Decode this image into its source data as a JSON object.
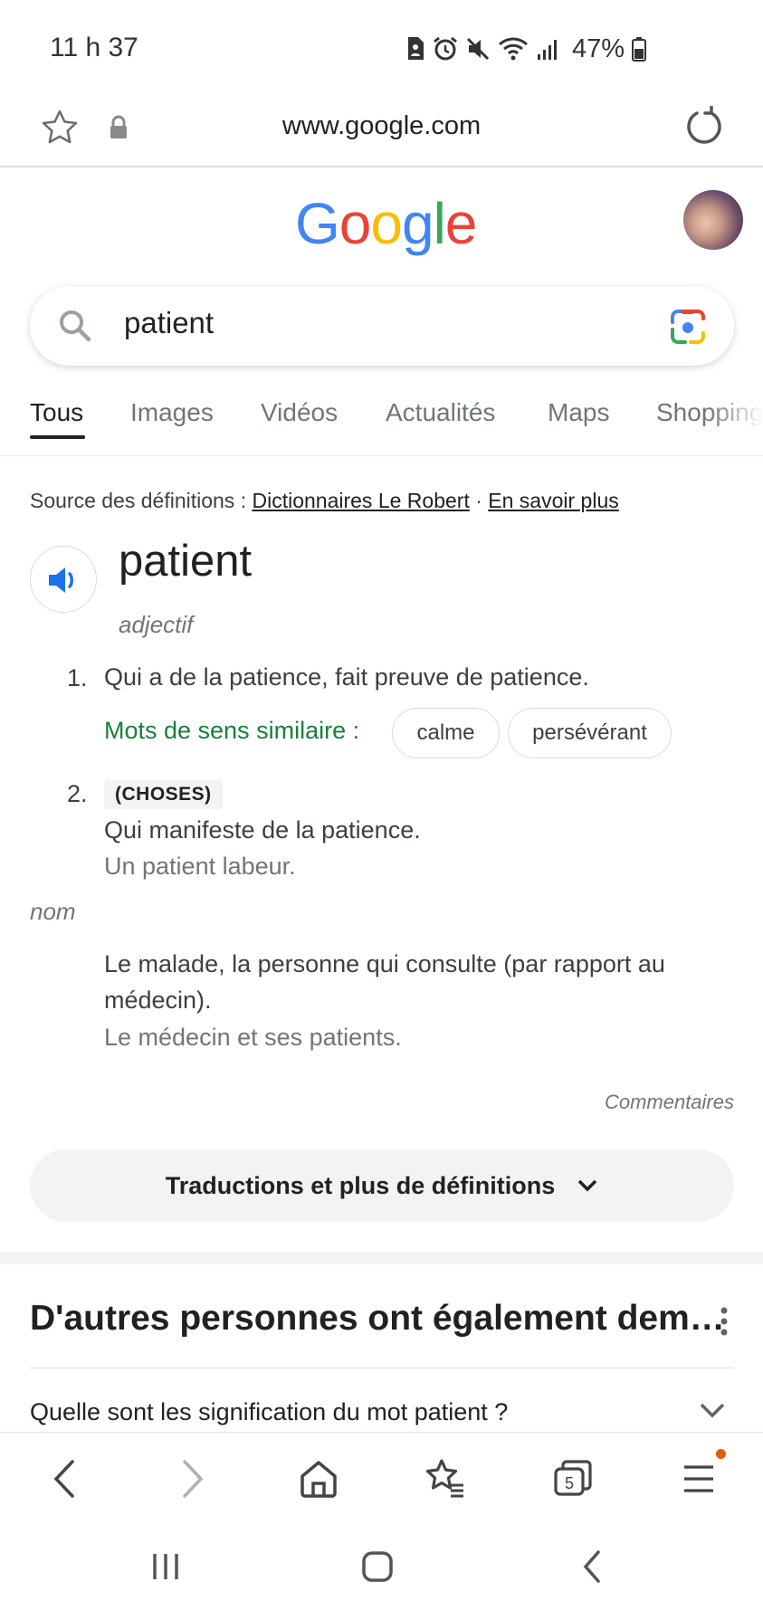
{
  "status_bar": {
    "time": "11 h 37",
    "battery": "47%",
    "icons": [
      "sim-icon",
      "alarm-icon",
      "mute-icon",
      "wifi-icon",
      "signal-icon",
      "battery-icon"
    ]
  },
  "browser": {
    "url": "www.google.com"
  },
  "google": {
    "logo_letters": [
      {
        "ch": "G",
        "color": "#4285F4"
      },
      {
        "ch": "o",
        "color": "#EA4335"
      },
      {
        "ch": "o",
        "color": "#FBBC05"
      },
      {
        "ch": "g",
        "color": "#4285F4"
      },
      {
        "ch": "l",
        "color": "#34A853"
      },
      {
        "ch": "e",
        "color": "#EA4335"
      }
    ]
  },
  "search": {
    "query": "patient"
  },
  "tabs": [
    {
      "label": "Tous",
      "active": true
    },
    {
      "label": "Images"
    },
    {
      "label": "Vidéos"
    },
    {
      "label": "Actualités"
    },
    {
      "label": "Maps"
    },
    {
      "label": "Shopping"
    }
  ],
  "definition": {
    "source_prefix": "Source des définitions :",
    "source_name": "Dictionnaires Le Robert",
    "separator": "·",
    "learn_more": "En savoir plus",
    "word": "patient",
    "adjective": {
      "pos": "adjectif",
      "senses": [
        {
          "num": "1.",
          "text": "Qui a de la patience, fait preuve de patience.",
          "similar_label": "Mots de sens similaire :",
          "similar": [
            "calme",
            "persévérant"
          ]
        },
        {
          "num": "2.",
          "tag": "(CHOSES)",
          "text": "Qui manifeste de la patience.",
          "example": "Un patient labeur."
        }
      ]
    },
    "noun": {
      "pos": "nom",
      "text_line1": "Le malade, la personne qui consulte (par rapport au",
      "text_line2": "médecin).",
      "example": "Le médecin et ses patients."
    },
    "comments": "Commentaires",
    "more_button": "Traductions et plus de définitions"
  },
  "people_also_ask": {
    "title": "D'autres personnes ont également dem…",
    "first_question": "Quelle sont les signification du mot patient ?"
  },
  "colors": {
    "accent_blue": "#1a73e8",
    "similar_green": "#188038",
    "notification_orange": "#e8590c"
  }
}
